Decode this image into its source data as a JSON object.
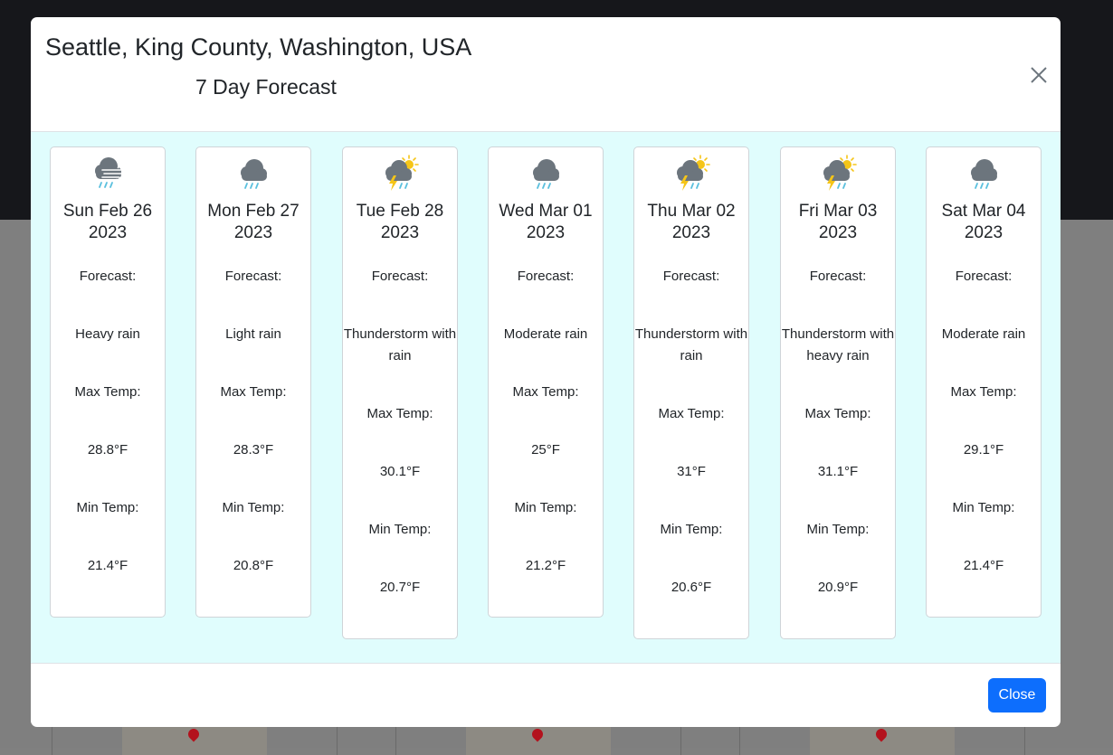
{
  "modal": {
    "title": "Seattle, King County, Washington, USA",
    "subtitle": "7 Day Forecast",
    "close_button_label": "Close"
  },
  "colors": {
    "primary": "#0d6efd",
    "body_bg": "#e0fdfd",
    "cloud": "#6c757d",
    "sun": "#f5c518",
    "rain": "#5bc0de"
  },
  "days": [
    {
      "date_line1": "Sun Feb 26",
      "date_line2": "2023",
      "forecast_label": "Forecast:",
      "condition": "Heavy rain",
      "max_label": "Max Temp:",
      "max_temp": "28.8°F",
      "min_label": "Min Temp:",
      "min_temp": "21.4°F",
      "icon": "wind-rain-icon"
    },
    {
      "date_line1": "Mon Feb 27",
      "date_line2": "2023",
      "forecast_label": "Forecast:",
      "condition": "Light rain",
      "max_label": "Max Temp:",
      "max_temp": "28.3°F",
      "min_label": "Min Temp:",
      "min_temp": "20.8°F",
      "icon": "cloud-rain-icon"
    },
    {
      "date_line1": "Tue Feb 28",
      "date_line2": "2023",
      "forecast_label": "Forecast:",
      "condition": "Thunderstorm with rain",
      "max_label": "Max Temp:",
      "max_temp": "30.1°F",
      "min_label": "Min Temp:",
      "min_temp": "20.7°F",
      "icon": "thunderstorm-sun-icon"
    },
    {
      "date_line1": "Wed Mar 01",
      "date_line2": "2023",
      "forecast_label": "Forecast:",
      "condition": "Moderate rain",
      "max_label": "Max Temp:",
      "max_temp": "25°F",
      "min_label": "Min Temp:",
      "min_temp": "21.2°F",
      "icon": "cloud-rain-icon"
    },
    {
      "date_line1": "Thu Mar 02",
      "date_line2": "2023",
      "forecast_label": "Forecast:",
      "condition": "Thunderstorm with rain",
      "max_label": "Max Temp:",
      "max_temp": "31°F",
      "min_label": "Min Temp:",
      "min_temp": "20.6°F",
      "icon": "thunderstorm-sun-icon"
    },
    {
      "date_line1": "Fri Mar 03",
      "date_line2": "2023",
      "forecast_label": "Forecast:",
      "condition": "Thunderstorm with heavy rain",
      "max_label": "Max Temp:",
      "max_temp": "31.1°F",
      "min_label": "Min Temp:",
      "min_temp": "20.9°F",
      "icon": "thunderstorm-sun-icon"
    },
    {
      "date_line1": "Sat Mar 04",
      "date_line2": "2023",
      "forecast_label": "Forecast:",
      "condition": "Moderate rain",
      "max_label": "Max Temp:",
      "max_temp": "29.1°F",
      "min_label": "Min Temp:",
      "min_temp": "21.4°F",
      "icon": "cloud-rain-icon"
    }
  ]
}
